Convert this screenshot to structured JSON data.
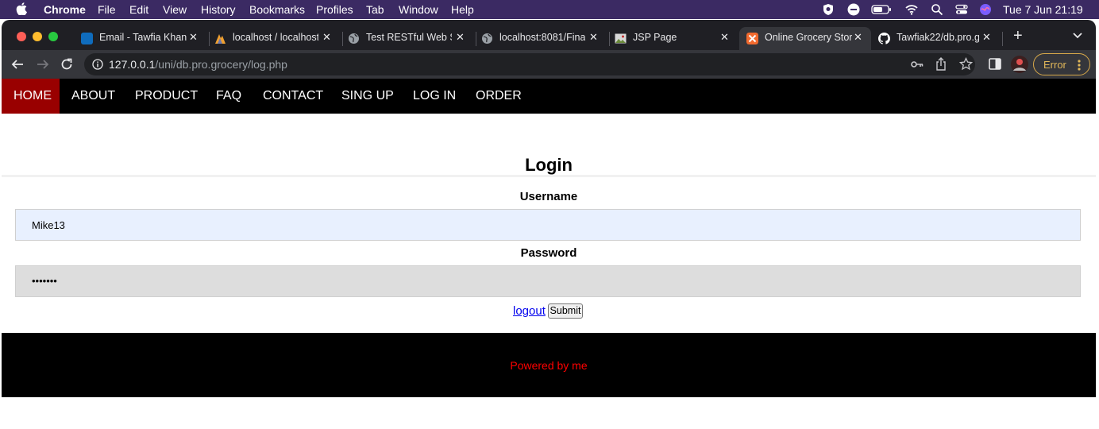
{
  "menubar": {
    "app_name": "Chrome",
    "items": [
      "File",
      "Edit",
      "View",
      "History",
      "Bookmarks",
      "Profiles",
      "Tab",
      "Window",
      "Help"
    ],
    "datetime": "Tue 7 Jun  21:19"
  },
  "tabs": [
    {
      "title": "Email - Tawfia Khan",
      "icon": "outlook-icon",
      "color": "#0f6cbd"
    },
    {
      "title": "localhost / localhost",
      "icon": "phpmyadmin-icon",
      "color": "#f0a030"
    },
    {
      "title": "Test RESTful Web S",
      "icon": "globe-icon",
      "color": "#9aa0a6"
    },
    {
      "title": "localhost:8081/Fina",
      "icon": "globe-icon",
      "color": "#9aa0a6"
    },
    {
      "title": "JSP Page",
      "icon": "image-icon",
      "color": "#c8c8c8"
    },
    {
      "title": "Online Grocery Stor",
      "icon": "xampp-icon",
      "color": "#f26a2e"
    },
    {
      "title": "Tawfiak22/db.pro.g",
      "icon": "github-icon",
      "color": "#ffffff"
    }
  ],
  "address_bar": {
    "host": "127.0.0.1",
    "path": "/uni/db.pro.grocery/log.php"
  },
  "profile_status": "Error",
  "nav": {
    "items": [
      "HOME",
      "ABOUT",
      "PRODUCT",
      "FAQ",
      "CONTACT",
      "SING UP",
      "LOG IN",
      "ORDER"
    ],
    "active": "HOME",
    "active_color": "#990000"
  },
  "login": {
    "title": "Login",
    "username_label": "Username",
    "username_value": "Mike13",
    "password_label": "Password",
    "password_value": "•••••••",
    "logout_label": "logout ",
    "submit_label": "Submit"
  },
  "footer": {
    "text": "Powered by me",
    "color": "#ff0000"
  }
}
